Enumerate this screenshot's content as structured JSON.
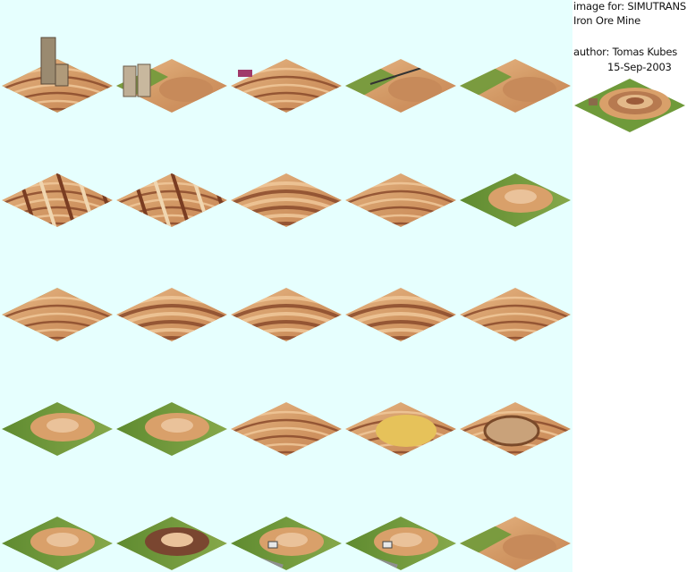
{
  "info": {
    "line1": "image for: SIMUTRANS",
    "line2": "Iron Ore Mine",
    "line3": "author: Tomas Kubes",
    "line4": "15-Sep-2003"
  },
  "colors": {
    "sheet_background": "#e6fffe",
    "page_background": "#ffffff",
    "grass": "#6f9a3a",
    "sand": "#d9a06a",
    "rock": "#8a4a2c",
    "highlight": "#f0c89a"
  },
  "tiles": [
    [
      "terrace-grass",
      "silo",
      "pit-ledge",
      "conveyor",
      "ore-heap"
    ],
    [
      "diagonal-strata",
      "diagonal-strata",
      "terrace-deep",
      "terrace-light",
      "grass-edge"
    ],
    [
      "road-terrace",
      "steep-pit",
      "terrace-deep",
      "terrace-deep",
      "terrace-light"
    ],
    [
      "mound",
      "mound",
      "terrace-light",
      "yellow-pit",
      "round-pit"
    ],
    [
      "tunnel",
      "dark-mound",
      "grass-truck",
      "yard",
      "ore-heap"
    ]
  ]
}
